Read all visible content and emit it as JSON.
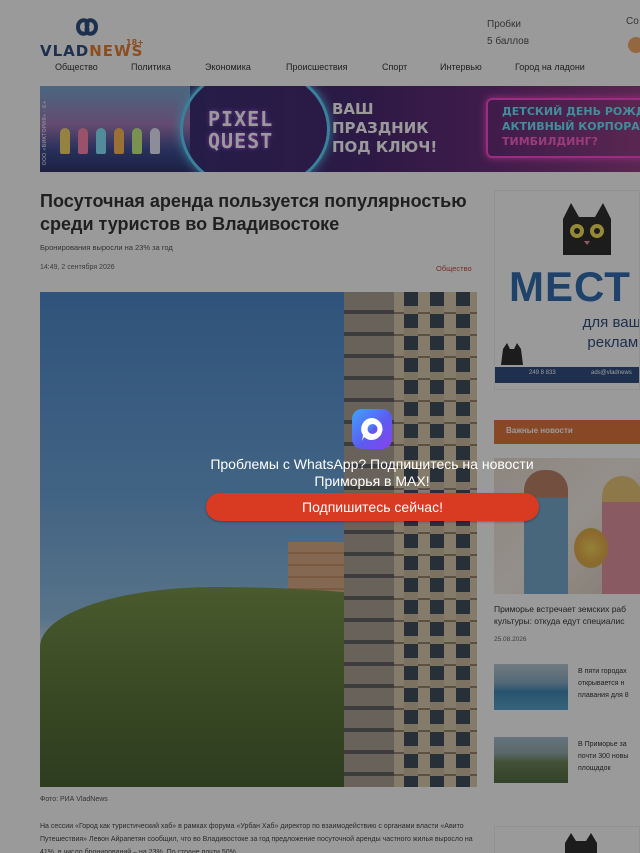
{
  "header": {
    "logo_text_vlad": "VLAD",
    "logo_text_news": "NEWS",
    "logo_age": "18+",
    "traffic_label": "Пробки",
    "traffic_value": "5 баллов",
    "weather_label_cut": "Со"
  },
  "nav": {
    "items": [
      {
        "label": "Общество"
      },
      {
        "label": "Политика"
      },
      {
        "label": "Экономика"
      },
      {
        "label": "Происшествия"
      },
      {
        "label": "Спорт"
      },
      {
        "label": "Интервью"
      },
      {
        "label": "Город на ладони"
      }
    ]
  },
  "banner": {
    "age_note": "ООО «ВИКТОРИЯ» · 6+",
    "brand_line1": "PIXEL",
    "brand_line2": "QUEST",
    "slogan_line1": "ВАШ",
    "slogan_line2": "ПРАЗДНИК",
    "slogan_line3": "ПОД КЛЮЧ!",
    "offer_line1": "ДЕТСКИЙ ДЕНЬ РОЖДЕ",
    "offer_line2": "АКТИВНЫЙ КОРПОРАТ",
    "offer_line3": "ТИМБИЛДИНГ?"
  },
  "article": {
    "title": "Посуточная аренда пользуется популярностью среди туристов во Владивостоке",
    "subtitle": "Бронирования выросли на 23% за год",
    "date": "14:49, 2 сентября 2026",
    "category": "Общество",
    "caption": "Фото: РИА VladNews",
    "body": "На сессии «Город как туристический хаб» в рамках форума «Урбан Хаб» директор по взаимодействию с органами власти «Авито Путешествия» Левон Айрапетян сообщил, что во Владивостоке за год предложение посуточной аренды частного жилья выросло на 41%, в число бронирований – на 23%. По стране почти 50%"
  },
  "sidebar": {
    "ad": {
      "big_text": "МЕСТ",
      "sub_line1": "для ваше",
      "sub_line2": "рекламы",
      "phone": "249 8 833",
      "site": "ads@vladnews"
    },
    "important_label": "Важные новости",
    "main_news": {
      "title_line1": "Приморье встречает земских раб",
      "title_line2": "культуры: откуда едут специалис",
      "date": "25.08.2026"
    },
    "items": [
      {
        "line1": "В пяти городах",
        "line2": "открывается н",
        "line3": "плавания для 8"
      },
      {
        "line1": "В Приморье за",
        "line2": "почти 300 новы",
        "line3": "площадок"
      }
    ]
  },
  "modal": {
    "message_line1": "Проблемы с WhatsApp? Подпишитесь на новости",
    "message_line2": "Приморья в MAX!",
    "button_label": "Подпишитесь сейчас!",
    "icon_name": "max-app-icon",
    "accent": "#d93a22"
  }
}
